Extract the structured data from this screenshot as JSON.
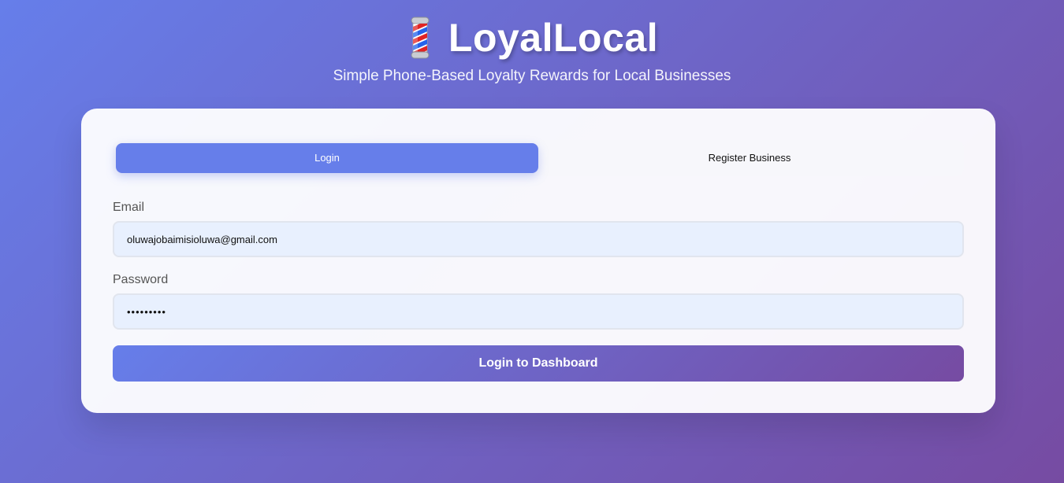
{
  "header": {
    "logo_icon": "barber-pole-icon",
    "title": "LoyalLocal",
    "subtitle": "Simple Phone-Based Loyalty Rewards for Local Businesses"
  },
  "tabs": [
    {
      "label": "Login",
      "active": true
    },
    {
      "label": "Register Business",
      "active": false
    }
  ],
  "form": {
    "email_label": "Email",
    "email_value": "oluwajobaimisioluwa@gmail.com",
    "password_label": "Password",
    "password_value": "•••••••••",
    "submit_label": "Login to Dashboard"
  },
  "colors": {
    "gradient_start": "#667eea",
    "gradient_end": "#764ba2",
    "active_tab": "#667eea",
    "input_background": "#e8f0fe",
    "card_background": "#ffffff"
  }
}
